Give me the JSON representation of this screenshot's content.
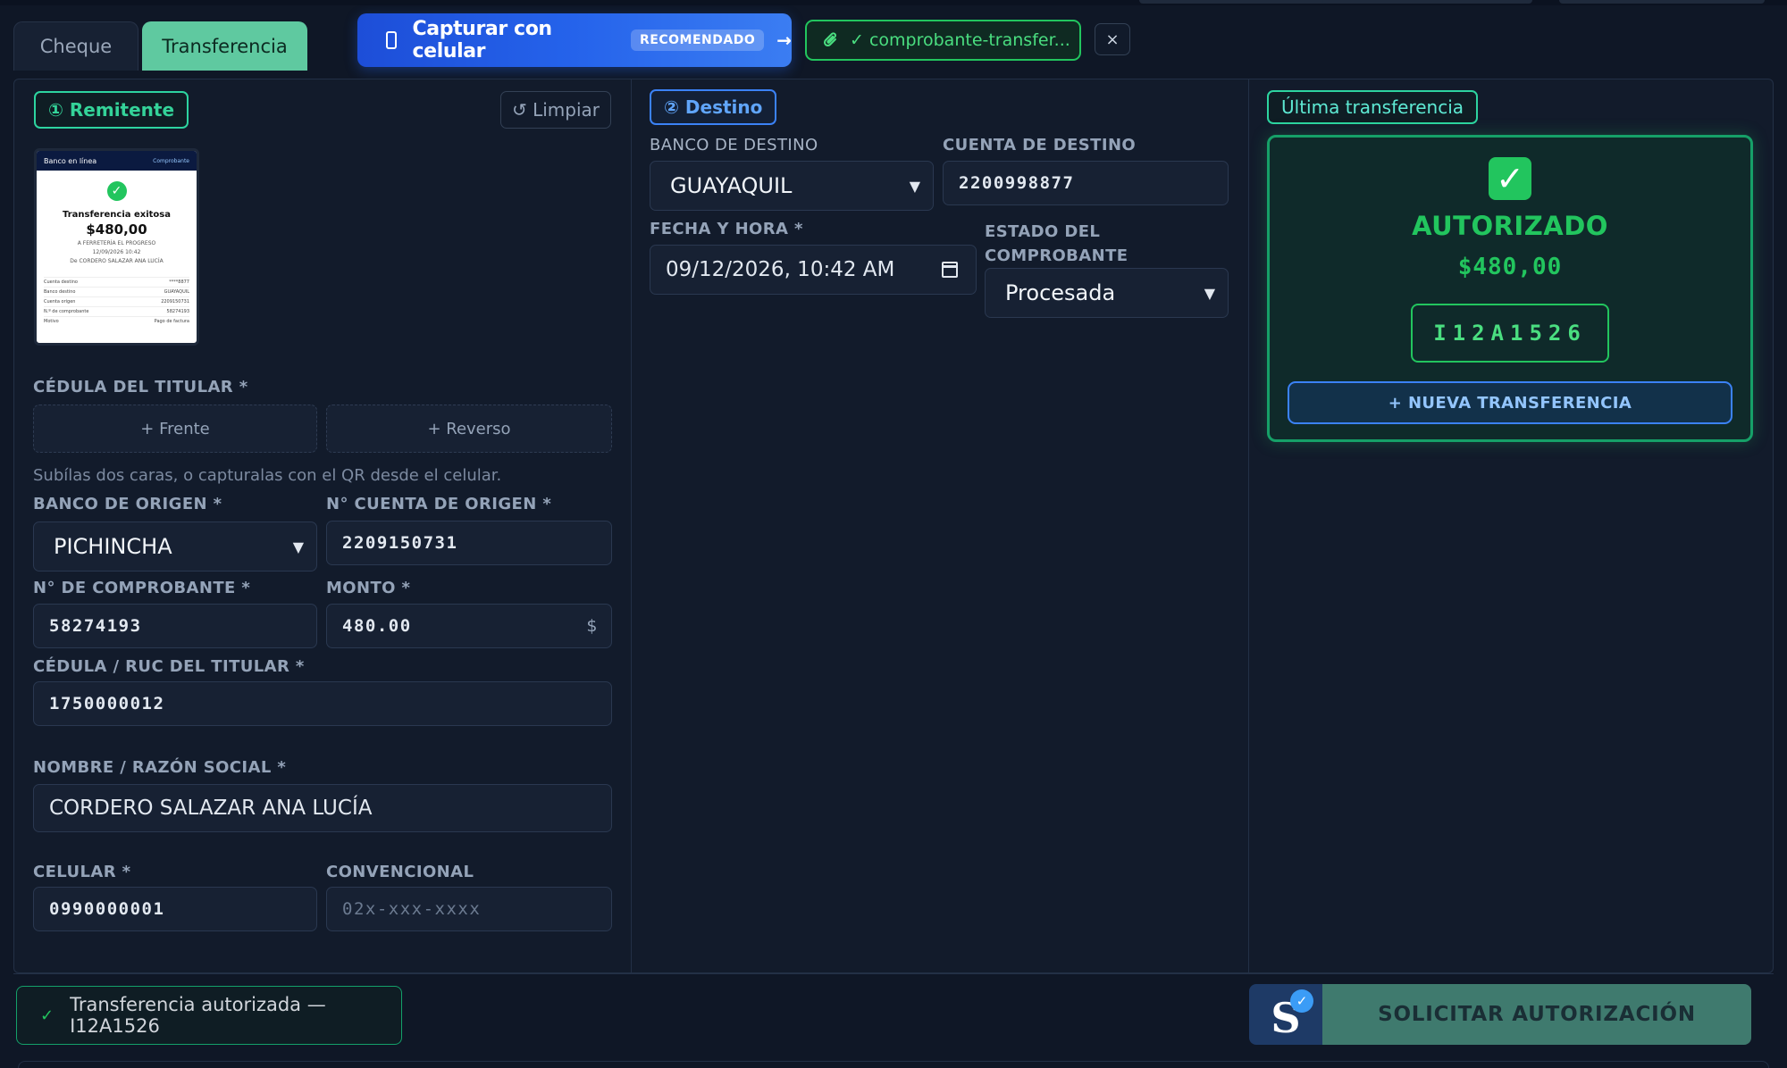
{
  "tabs": [
    {
      "label": "Cheque",
      "active": false
    },
    {
      "label": "Transferencia",
      "active": true
    }
  ],
  "capture": {
    "label": "Capturar con celular",
    "badge": "RECOMENDADO",
    "arrow": "→",
    "icon": "phone-icon"
  },
  "attachment": {
    "label": "✓ comprobante-transfer...",
    "icon": "paperclip-icon",
    "close": "×"
  },
  "remitente": {
    "tag": "① Remitente",
    "clear_label": "↺ Limpiar",
    "receipt_thumb": {
      "bank": "Banco en línea",
      "header_right": "Comprobante",
      "title": "Transferencia exitosa",
      "amount": "$480,00",
      "to": "A FERRETERÍA EL PROGRESO",
      "date": "12/09/2026 10:42",
      "from": "De CORDERO SALAZAR ANA LUCÍA",
      "rows": [
        {
          "k": "Cuenta destino",
          "v": "****8877"
        },
        {
          "k": "Banco destino",
          "v": "GUAYAQUIL"
        },
        {
          "k": "Cuenta origen",
          "v": "2209150731"
        },
        {
          "k": "N.º de comprobante",
          "v": "58274193"
        },
        {
          "k": "Motivo",
          "v": "Pago de factura"
        }
      ]
    },
    "cedula_label": "CÉDULA DEL TITULAR *",
    "front_label": "+ Frente",
    "back_label": "+ Reverso",
    "hint": "Subílas dos caras, o capturalas con el QR desde el celular.",
    "bank_label": "BANCO DE ORIGEN *",
    "bank_value": "PICHINCHA",
    "account_label": "N° CUENTA DE ORIGEN *",
    "account_value": "2209150731",
    "voucher_label": "N° DE COMPROBANTE *",
    "voucher_value": "58274193",
    "amount_label": "MONTO *",
    "amount_value": "480.00",
    "amount_suffix": "$",
    "ruc_label": "CÉDULA / RUC DEL TITULAR *",
    "ruc_value": "1750000012",
    "name_label": "NOMBRE / RAZÓN SOCIAL *",
    "name_value": "CORDERO SALAZAR ANA LUCÍA",
    "cell_label": "CELULAR *",
    "cell_value": "0990000001",
    "phone_label": "CONVENCIONAL",
    "phone_placeholder": "02x-xxx-xxxx"
  },
  "destino": {
    "tag": "② Destino",
    "bank_label": "BANCO DE DESTINO",
    "bank_value": "GUAYAQUIL",
    "account_label": "CUENTA DE DESTINO",
    "account_value": "2200998877",
    "datetime_label": "FECHA Y HORA *",
    "datetime_value": "09/12/2026, 10:42 AM",
    "status_label_1": "ESTADO DEL",
    "status_label_2": "COMPROBANTE",
    "status_value": "Procesada"
  },
  "last": {
    "tag": "Última transferencia",
    "status": "AUTORIZADO",
    "amount": "$480,00",
    "code": "I12A1526",
    "new_label": "+ NUEVA TRANSFERENCIA"
  },
  "footer": {
    "toast_check": "✓",
    "toast": "Transferencia autorizada — I12A1526",
    "brand_letter": "S",
    "submit_label": "SOLICITAR AUTORIZACIÓN"
  },
  "colors": {
    "accent_green": "#22c55e",
    "tab_active": "#5fc9a0",
    "capture_blue": "#2563eb",
    "background": "#0f1726"
  }
}
